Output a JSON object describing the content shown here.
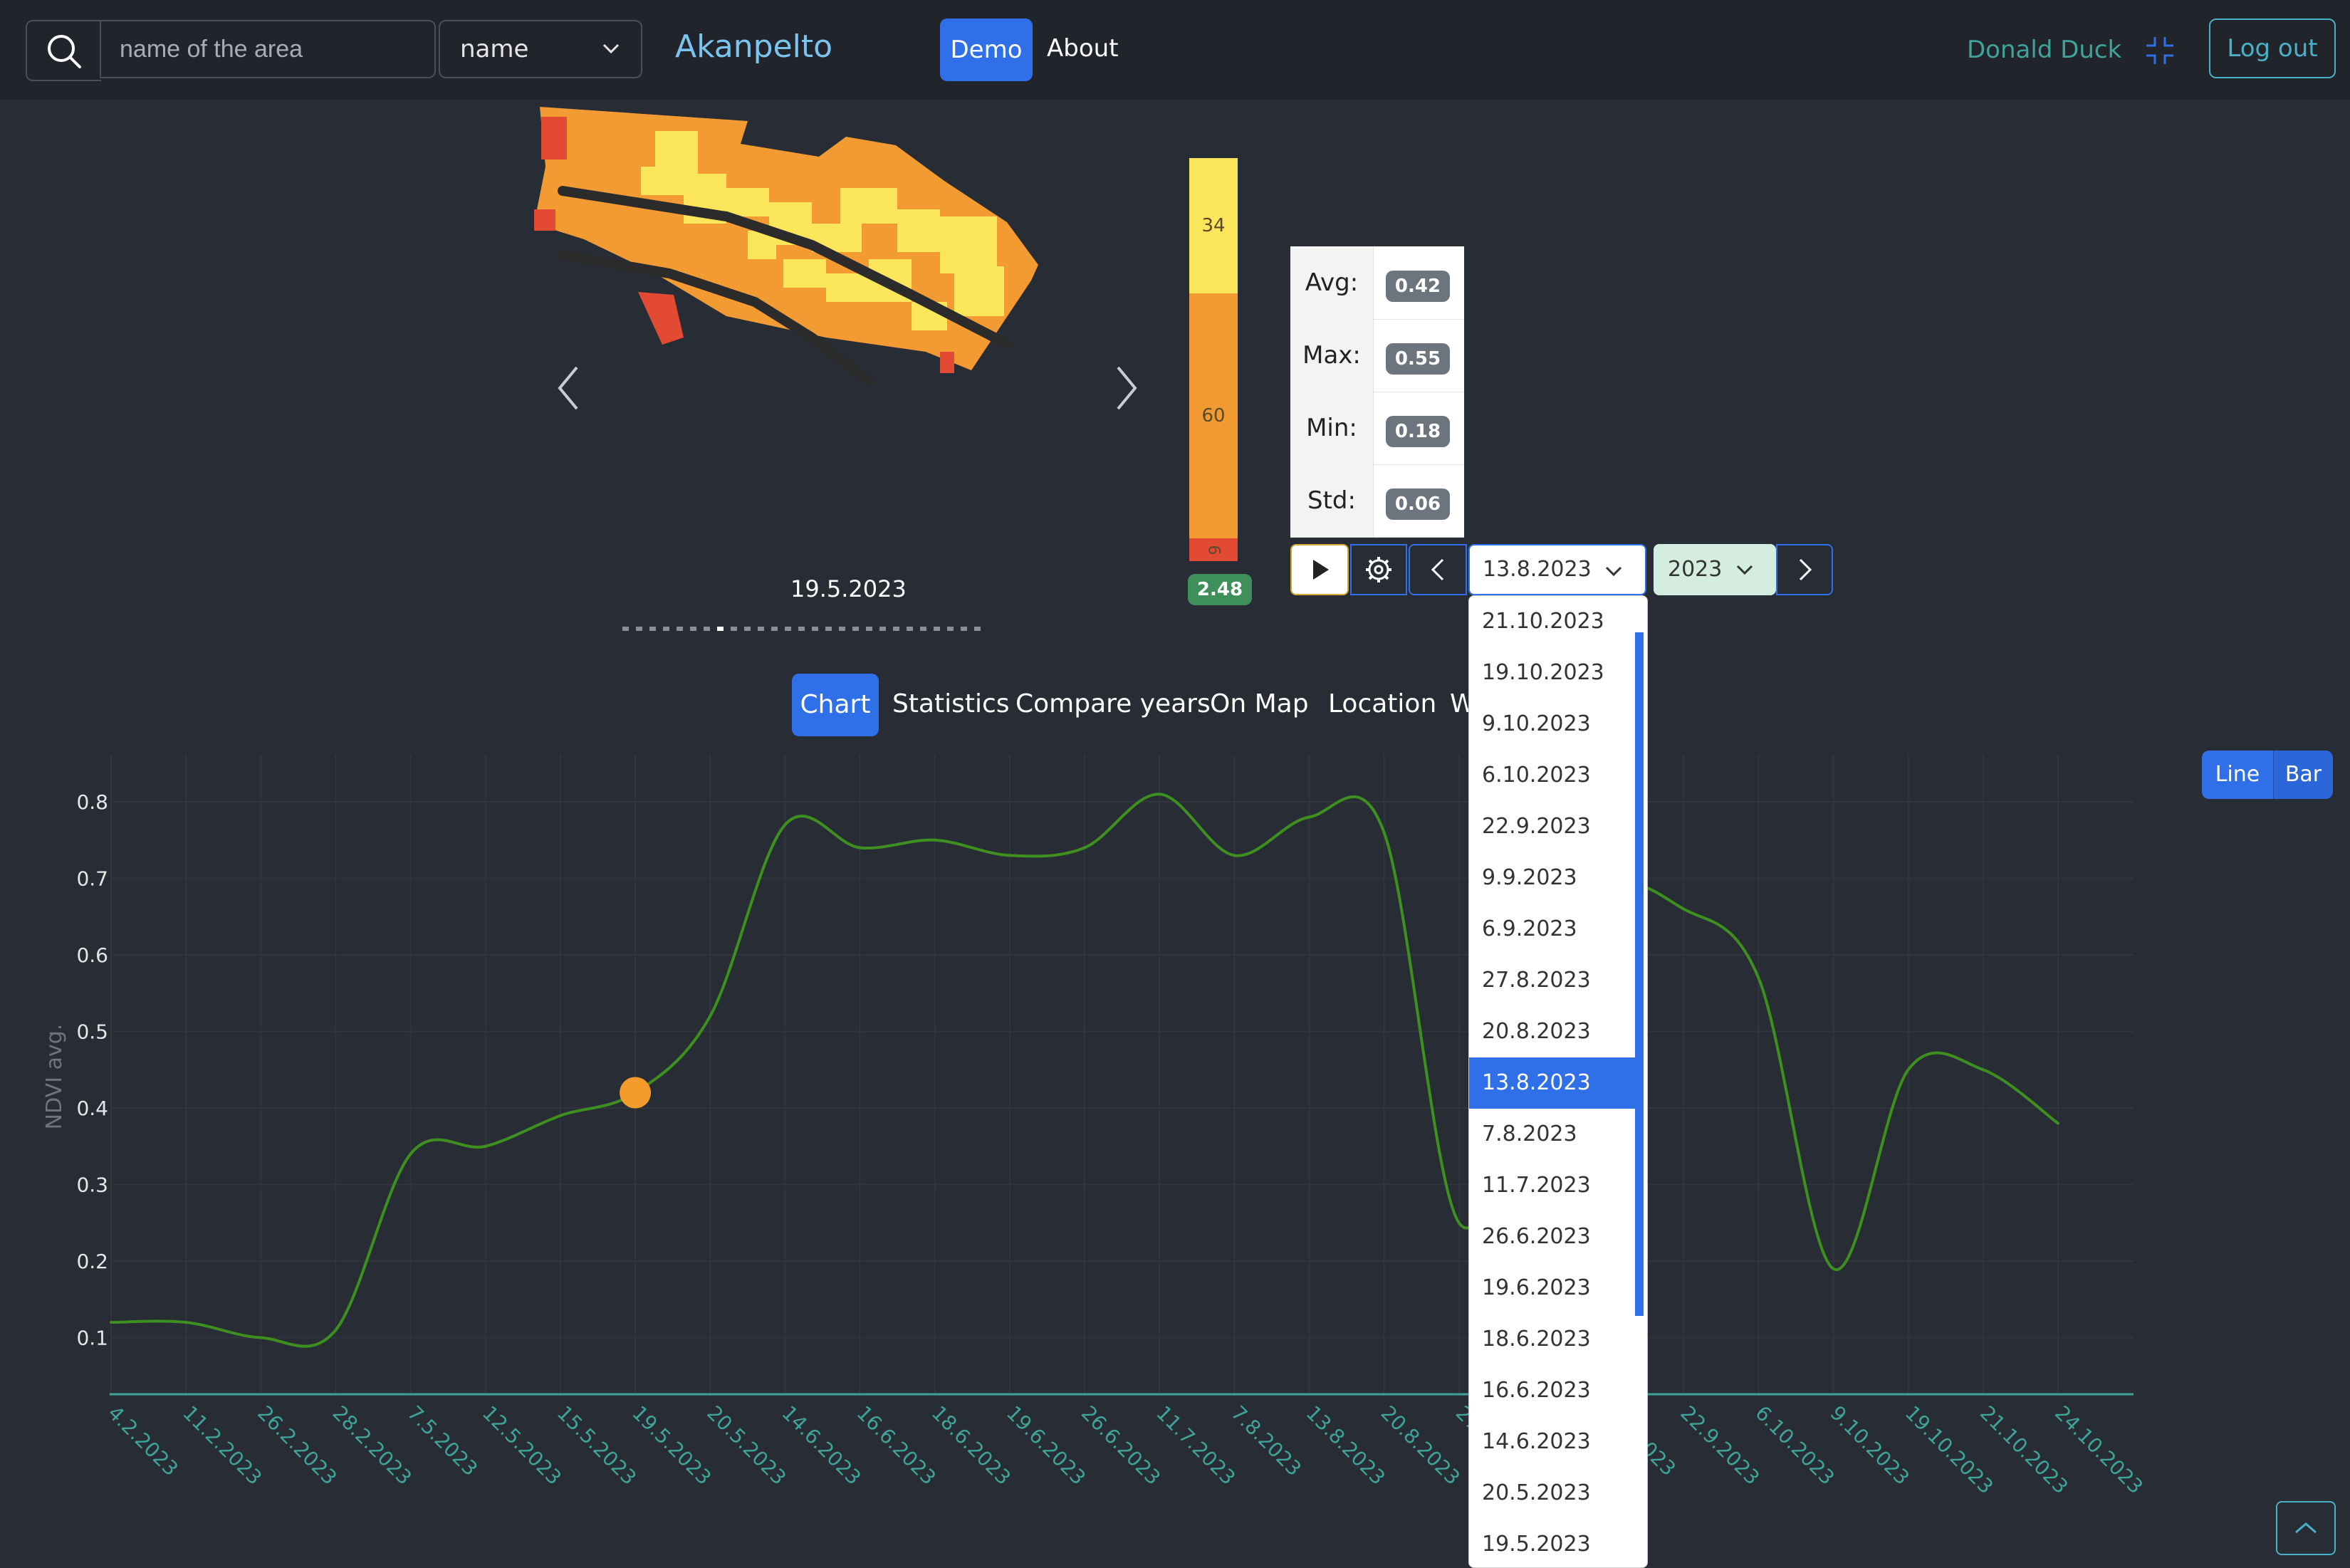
{
  "navbar": {
    "search_placeholder": "name of the area",
    "field_select": "name",
    "brand": "Akanpelto",
    "demo_label": "Demo",
    "about_label": "About",
    "user_name": "Donald Duck",
    "logout_label": "Log out"
  },
  "map": {
    "date": "19.5.2023",
    "legend": {
      "top": "34",
      "middle": "60",
      "bottom": "6",
      "value_badge": "2.48"
    }
  },
  "stats": {
    "avg_label": "Avg:",
    "avg_value": "0.42",
    "max_label": "Max:",
    "max_value": "0.55",
    "min_label": "Min:",
    "min_value": "0.18",
    "std_label": "Std:",
    "std_value": "0.06"
  },
  "controls": {
    "selected_date": "13.8.2023",
    "selected_year": "2023"
  },
  "date_options": [
    "21.10.2023",
    "19.10.2023",
    "9.10.2023",
    "6.10.2023",
    "22.9.2023",
    "9.9.2023",
    "6.9.2023",
    "27.8.2023",
    "20.8.2023",
    "13.8.2023",
    "7.8.2023",
    "11.7.2023",
    "26.6.2023",
    "19.6.2023",
    "18.6.2023",
    "16.6.2023",
    "14.6.2023",
    "20.5.2023",
    "19.5.2023"
  ],
  "tabs": {
    "chart": "Chart",
    "statistics": "Statistics",
    "compare_years": "Compare years",
    "on_map": "On Map",
    "location": "Location",
    "weather": "W"
  },
  "chart_toggle": {
    "line": "Line",
    "bar": "Bar"
  },
  "colors": {
    "accent": "#2f6fe8",
    "series": "#3d8f1f",
    "highlight": "#f39c2c"
  },
  "chart_data": {
    "type": "line",
    "ylabel": "NDVI avg.",
    "ylim": [
      0,
      0.85
    ],
    "yticks": [
      "0.1",
      "0.2",
      "0.3",
      "0.4",
      "0.5",
      "0.6",
      "0.7",
      "0.8"
    ],
    "x": [
      "4.2.2023",
      "11.2.2023",
      "26.2.2023",
      "28.2.2023",
      "7.5.2023",
      "12.5.2023",
      "15.5.2023",
      "19.5.2023",
      "20.5.2023",
      "14.6.2023",
      "16.6.2023",
      "18.6.2023",
      "19.6.2023",
      "26.6.2023",
      "11.7.2023",
      "7.8.2023",
      "13.8.2023",
      "20.8.2023",
      "27.8.2023",
      "6.9.2023",
      "9.9.2023",
      "22.9.2023",
      "6.10.2023",
      "9.10.2023",
      "19.10.2023",
      "21.10.2023",
      "24.10.2023"
    ],
    "series": [
      {
        "values": [
          0.12,
          0.12,
          0.1,
          0.11,
          0.34,
          0.35,
          0.39,
          0.42,
          0.52,
          0.77,
          0.74,
          0.75,
          0.73,
          0.74,
          0.81,
          0.73,
          0.78,
          0.76,
          0.25,
          0.48,
          0.68,
          0.66,
          0.57,
          0.19,
          0.45,
          0.45,
          0.38
        ]
      }
    ],
    "highlight_x": "19.5.2023",
    "grid": true
  }
}
